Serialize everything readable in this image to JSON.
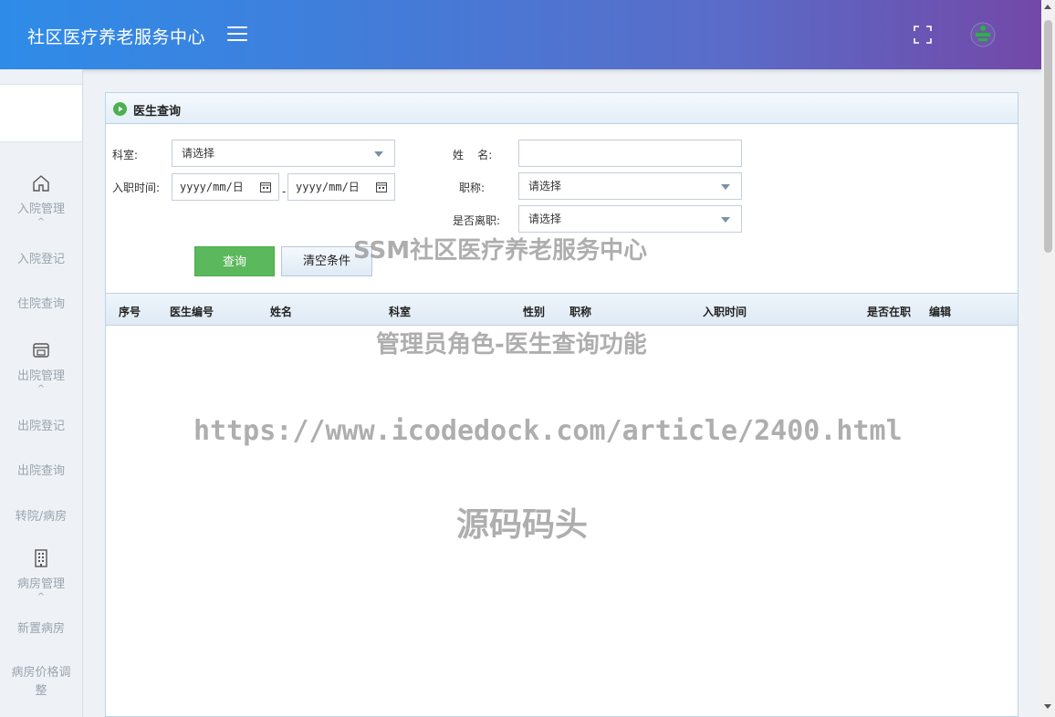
{
  "header": {
    "title": "社区医疗养老服务中心",
    "menu_icon": "hamburger-icon",
    "fullscreen_icon": "fullscreen-icon",
    "avatar_icon": "user-avatar-icon"
  },
  "sidebar": {
    "groups": [
      {
        "label": "入院管理",
        "icon": "home-icon",
        "items": [
          "入院登记",
          "住院查询"
        ]
      },
      {
        "label": "出院管理",
        "icon": "window-icon",
        "items": [
          "出院登记",
          "出院查询",
          "转院/病房"
        ]
      },
      {
        "label": "病房管理",
        "icon": "building-icon",
        "items": [
          "新置病房",
          "病房价格调整"
        ]
      }
    ]
  },
  "panel": {
    "title": "医生查询",
    "form": {
      "department_label": "科室:",
      "department_value": "请选择",
      "name_label": "姓    名:",
      "name_value": "",
      "hire_date_label": "入职时间:",
      "date_from": "yyyy/mm/日",
      "date_to": "yyyy/mm/日",
      "date_sep": "-",
      "title_label": "职称:",
      "title_value": "请选择",
      "resigned_label": "是否离职:",
      "resigned_value": "请选择",
      "query_button": "查询",
      "clear_button": "清空条件"
    },
    "table": {
      "columns": [
        "序号",
        "医生编号",
        "姓名",
        "科室",
        "性别",
        "职称",
        "入职时间",
        "是否在职",
        "编辑"
      ]
    }
  },
  "watermarks": {
    "line1": "SSM社区医疗养老服务中心",
    "line2": "管理员角色-医生查询功能",
    "line3": "https://www.icodedock.com/article/2400.html",
    "line4": "源码码头"
  },
  "colors": {
    "header_start": "#2e8ce8",
    "header_end": "#7348a8",
    "query_button": "#5cb85c",
    "panel_border": "#bcd3e6"
  }
}
